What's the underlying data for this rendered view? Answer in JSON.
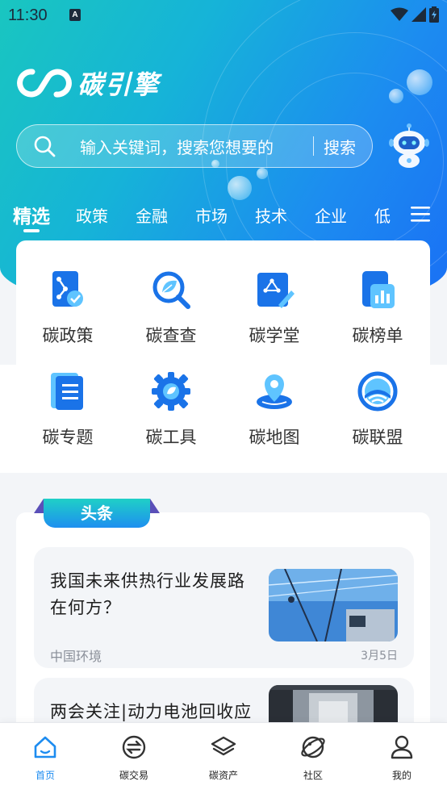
{
  "status_bar": {
    "time": "11:30",
    "notice_badge": "A"
  },
  "brand": {
    "name": "碳引擎"
  },
  "search": {
    "placeholder": "输入关键词，搜索您想要的",
    "button_label": "搜索"
  },
  "tabs": [
    {
      "label": "精选",
      "active": true
    },
    {
      "label": "政策"
    },
    {
      "label": "金融"
    },
    {
      "label": "市场"
    },
    {
      "label": "技术"
    },
    {
      "label": "企业"
    },
    {
      "label": "低"
    }
  ],
  "features": [
    {
      "label": "碳政策",
      "icon": "policy-icon"
    },
    {
      "label": "碳查查",
      "icon": "search-leaf-icon"
    },
    {
      "label": "碳学堂",
      "icon": "classroom-icon"
    },
    {
      "label": "碳榜单",
      "icon": "ranking-icon"
    },
    {
      "label": "碳专题",
      "icon": "topic-icon"
    },
    {
      "label": "碳工具",
      "icon": "tools-gear-icon"
    },
    {
      "label": "碳地图",
      "icon": "map-pin-icon"
    },
    {
      "label": "碳联盟",
      "icon": "alliance-icon"
    }
  ],
  "headlines": {
    "tag": "头条",
    "articles": [
      {
        "title": "我国未来供热行业发展路在何方？",
        "source": "中国环境",
        "date": "3月5日"
      },
      {
        "title": "两会关注|动力电池回收应避免“货币驱逐良币”",
        "source": "",
        "date": ""
      }
    ]
  },
  "bottom_nav": [
    {
      "label": "首页",
      "icon": "home-icon",
      "active": true
    },
    {
      "label": "碳交易",
      "icon": "exchange-icon"
    },
    {
      "label": "碳资产",
      "icon": "layers-icon"
    },
    {
      "label": "社区",
      "icon": "planet-icon"
    },
    {
      "label": "我的",
      "icon": "profile-icon"
    }
  ],
  "colors": {
    "accent": "#1d8cf0",
    "hero_start": "#19c6c0",
    "hero_end": "#1a6ff5",
    "icon_blue": "#1a73e8"
  }
}
